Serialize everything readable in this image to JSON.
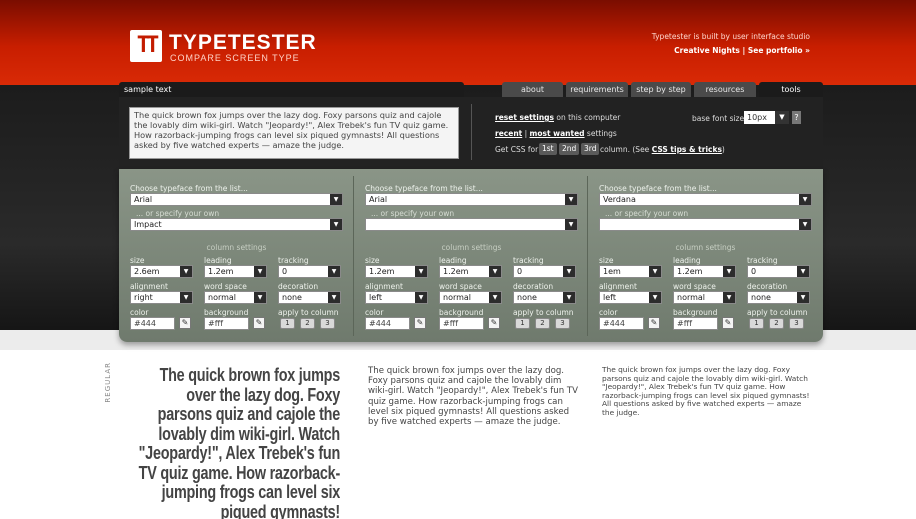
{
  "header": {
    "logo_glyph": "TT",
    "title": "TYPETESTER",
    "subtitle": "COMPARE SCREEN TYPE",
    "credit_line1": "Typetester is built by user interface studio",
    "credit_line2": "Creative Nights | See portfolio »"
  },
  "tabs": {
    "sample": "sample text",
    "about": "about",
    "requirements": "requirements",
    "step": "step by step",
    "resources": "resources",
    "tools": "tools"
  },
  "sample_text": "The quick brown fox jumps over the lazy dog. Foxy parsons quiz and cajole the lovably dim wiki-girl. Watch \"Jeopardy!\", Alex Trebek's fun TV quiz game. How razorback-jumping frogs can level six piqued gymnasts! All questions asked by five watched experts — amaze the judge.",
  "tools": {
    "reset_link": "reset settings",
    "reset_rest": " on this computer",
    "recent_link": "recent",
    "sep": " | ",
    "most_wanted_link": "most wanted",
    "settings_word": " settings",
    "getcss_label": "Get CSS for:",
    "col1": "1st",
    "col2": "2nd",
    "col3": "3rd",
    "column_word": "column. (See",
    "css_tips_link": "CSS tips & tricks",
    "close_paren": ")",
    "base_font_label": "base font size:",
    "base_font_value": "10px",
    "help": "?"
  },
  "labels": {
    "choose": "Choose typeface from the list...",
    "specify": "... or specify your own",
    "column_settings": "column settings",
    "size": "size",
    "leading": "leading",
    "tracking": "tracking",
    "alignment": "alignment",
    "word_space": "word space",
    "decoration": "decoration",
    "color": "color",
    "background": "background",
    "apply": "apply to column",
    "btn1": "1",
    "btn2": "2",
    "btn3": "3",
    "picker": "✎"
  },
  "columns": [
    {
      "typeface": "Arial",
      "custom": "Impact",
      "size": "2.6em",
      "leading": "1.2em",
      "tracking": "0",
      "alignment": "right",
      "word_space": "normal",
      "decoration": "none",
      "color": "#444",
      "background": "#fff"
    },
    {
      "typeface": "Arial",
      "custom": "",
      "size": "1.2em",
      "leading": "1.2em",
      "tracking": "0",
      "alignment": "left",
      "word_space": "normal",
      "decoration": "none",
      "color": "#444",
      "background": "#fff"
    },
    {
      "typeface": "Verdana",
      "custom": "",
      "size": "1em",
      "leading": "1.2em",
      "tracking": "0",
      "alignment": "left",
      "word_space": "normal",
      "decoration": "none",
      "color": "#444",
      "background": "#fff"
    }
  ],
  "preview": {
    "style_label": "REGULAR",
    "col1": "The quick brown fox jumps over the lazy dog. Foxy parsons quiz and cajole the lovably dim wiki-girl. Watch \"Jeopardy!\", Alex Trebek's fun TV quiz game. How razorback-jumping frogs can level six piqued gymnasts!",
    "col2": "The quick brown fox jumps over the lazy dog. Foxy parsons quiz and cajole the lovably dim wiki-girl. Watch \"Jeopardy!\", Alex Trebek's fun TV quiz game. How razorback-jumping frogs can level six piqued gymnasts! All questions asked by five watched experts — amaze the judge.",
    "col3": "The quick brown fox jumps over the lazy dog. Foxy parsons quiz and cajole the lovably dim wiki-girl. Watch \"Jeopardy!\", Alex Trebek's fun TV quiz game. How razorback-jumping frogs can level six piqued gymnasts! All questions asked by five watched experts — amaze the judge."
  },
  "colors": {
    "header_red": "#c81e00",
    "panel_green": "#7d887a",
    "dark": "#222222"
  }
}
